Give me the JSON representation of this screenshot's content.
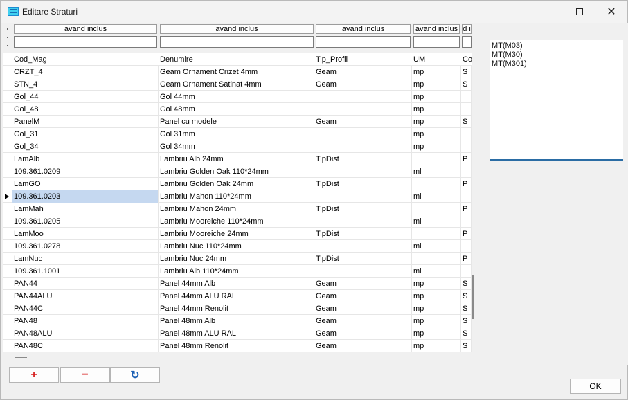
{
  "window": {
    "title": "Editare Straturi"
  },
  "filters": [
    "avand inclus",
    "avand inclus",
    "avand inclus",
    "avand inclus",
    "d i"
  ],
  "columns": [
    "Cod_Mag",
    "Denumire",
    "Tip_Profil",
    "UM",
    "Co"
  ],
  "rows": [
    [
      "CRZT_4",
      "Geam Ornament Crizet 4mm",
      "Geam",
      "mp",
      "S"
    ],
    [
      "STN_4",
      "Geam Ornament Satinat 4mm",
      "Geam",
      "mp",
      "S"
    ],
    [
      "Gol_44",
      "Gol 44mm",
      "",
      "mp",
      ""
    ],
    [
      "Gol_48",
      "Gol 48mm",
      "",
      "mp",
      ""
    ],
    [
      "PanelM",
      "Panel cu modele",
      "Geam",
      "mp",
      "S"
    ],
    [
      "Gol_31",
      "Gol 31mm",
      "",
      "mp",
      ""
    ],
    [
      "Gol_34",
      "Gol 34mm",
      "",
      "mp",
      ""
    ],
    [
      "LamAlb",
      "Lambriu Alb 24mm",
      "TipDist",
      "",
      "P"
    ],
    [
      "109.361.0209",
      "Lambriu Golden Oak 110*24mm",
      "",
      "ml",
      ""
    ],
    [
      "LamGO",
      "Lambriu Golden Oak 24mm",
      "TipDist",
      "",
      "P"
    ],
    [
      "109.361.0203",
      "Lambriu Mahon 110*24mm",
      "",
      "ml",
      ""
    ],
    [
      "LamMah",
      "Lambriu Mahon 24mm",
      "TipDist",
      "",
      "P"
    ],
    [
      "109.361.0205",
      "Lambriu Mooreiche 110*24mm",
      "",
      "ml",
      ""
    ],
    [
      "LamMoo",
      "Lambriu Mooreiche 24mm",
      "TipDist",
      "",
      "P"
    ],
    [
      "109.361.0278",
      "Lambriu Nuc 110*24mm",
      "",
      "ml",
      ""
    ],
    [
      "LamNuc",
      "Lambriu Nuc 24mm",
      "TipDist",
      "",
      "P"
    ],
    [
      "109.361.1001",
      "Lambriu Alb 110*24mm",
      "",
      "ml",
      ""
    ],
    [
      "PAN44",
      "Panel 44mm Alb",
      "Geam",
      "mp",
      "S"
    ],
    [
      "PAN44ALU",
      "Panel 44mm ALU RAL",
      "Geam",
      "mp",
      "S"
    ],
    [
      "PAN44C",
      "Panel 44mm Renolit",
      "Geam",
      "mp",
      "S"
    ],
    [
      "PAN48",
      "Panel 48mm Alb",
      "Geam",
      "mp",
      "S"
    ],
    [
      "PAN48ALU",
      "Panel 48mm ALU RAL",
      "Geam",
      "mp",
      "S"
    ],
    [
      "PAN48C",
      "Panel 48mm Renolit",
      "Geam",
      "mp",
      "S"
    ]
  ],
  "selected_row": 10,
  "toolbar": {
    "add_label": "+",
    "remove_label": "−",
    "refresh_label": "↻"
  },
  "side_list": [
    "MT(M03)",
    "MT(M30)",
    "MT(M301)"
  ],
  "ok_label": "OK"
}
